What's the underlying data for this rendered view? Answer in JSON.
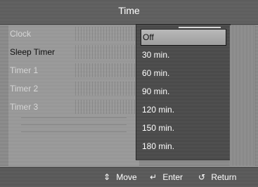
{
  "window": {
    "title": "Time"
  },
  "menu": {
    "items": [
      {
        "label": "Clock",
        "state": "disabled"
      },
      {
        "label": "Sleep Timer",
        "state": "active"
      },
      {
        "label": "Timer 1",
        "state": "disabled"
      },
      {
        "label": "Timer 2",
        "state": "disabled"
      },
      {
        "label": "Timer 3",
        "state": "disabled"
      }
    ]
  },
  "dropdown": {
    "selected": "Off",
    "options": [
      "Off",
      "30 min.",
      "60 min.",
      "90 min.",
      "120 min.",
      "150 min.",
      "180 min."
    ]
  },
  "footer": {
    "move": {
      "icon": "up-down-arrows-icon",
      "label": "Move"
    },
    "enter": {
      "icon": "enter-icon",
      "label": "Enter"
    },
    "return": {
      "icon": "return-icon",
      "label": "Return"
    }
  },
  "colors": {
    "text_active": "#111111",
    "text_disabled": "#d6d6d6",
    "text_light": "#ffffff"
  }
}
